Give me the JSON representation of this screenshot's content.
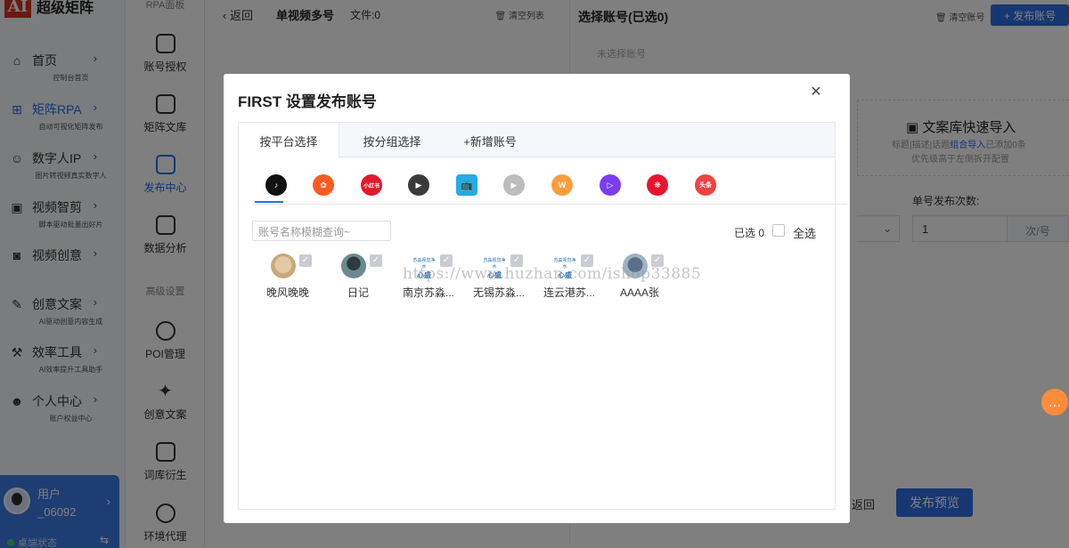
{
  "app": {
    "logo_mark": "AI",
    "logo_text": "超级矩阵"
  },
  "sidebar": {
    "items": [
      {
        "label": "首页",
        "sub": "控制台首页",
        "icon": "home-icon"
      },
      {
        "label": "矩阵RPA",
        "sub": "自动可视化矩阵发布",
        "icon": "rpa-icon"
      },
      {
        "label": "数字人IP",
        "sub": "图片转视频真实数字人",
        "icon": "robot-icon"
      },
      {
        "label": "视频智剪",
        "sub": "脚本驱动批量出好片",
        "icon": "video-edit-icon"
      },
      {
        "label": "视频创意",
        "sub": "",
        "icon": "camera-icon"
      },
      {
        "label": "创意文案",
        "sub": "AI驱动创意内容生成",
        "icon": "copywriting-icon"
      },
      {
        "label": "效率工具",
        "sub": "AI效率提升工具助手",
        "icon": "tools-icon"
      },
      {
        "label": "个人中心",
        "sub": "账户权益中心",
        "icon": "user-icon"
      }
    ],
    "arrow": "›",
    "user": {
      "name": "用户\n_06092",
      "status": "桌端状态",
      "arrow": "›",
      "toggle": "⇆"
    }
  },
  "toolbar": {
    "top_partial": "RPA面板",
    "items": [
      "账号授权",
      "矩阵文库",
      "发布中心",
      "数据分析"
    ],
    "section": "高级设置",
    "items2": [
      "POI管理",
      "创意文案",
      "词库衍生",
      "环境代理"
    ]
  },
  "mid": {
    "back": "‹  返回",
    "title": "单视频多号",
    "file_count": "文件:0",
    "clear": "清空列表"
  },
  "right": {
    "title": "选择账号(已选0)",
    "clear": "清空账号",
    "publish": "+ 发布账号",
    "unselected": "未选择账号",
    "import_title": "文案库快速导入",
    "import_line1_pre": "标题|描述|话题",
    "import_line1_link": "组合导入",
    "import_line1_post": "已添加0条",
    "import_line2": "优先级高于左侧拆开配置",
    "count_label": "单号发布次数:",
    "count_value": "1",
    "count_unit": "次/号",
    "return": "返回",
    "preview": "发布预览"
  },
  "dialog": {
    "title": "FIRST 设置发布账号",
    "close": "✕",
    "tabs": [
      "按平台选择",
      "按分组选择",
      "+新增账号"
    ],
    "platforms": [
      {
        "name": "douyin-icon",
        "glyph": "♪",
        "color": "#111111"
      },
      {
        "name": "kuaishou-icon",
        "glyph": "✿",
        "color": "#ff5a1f"
      },
      {
        "name": "xiaohongshu-icon",
        "glyph": "小红书",
        "color": "#e3182d"
      },
      {
        "name": "video-channel-icon",
        "glyph": "▶",
        "color": "#3a3a3a"
      },
      {
        "name": "bilibili-icon",
        "glyph": "📺",
        "color": "#23ade5"
      },
      {
        "name": "xigua-icon",
        "glyph": "▶",
        "color": "#bcbcbc"
      },
      {
        "name": "wechat-channels-icon",
        "glyph": "W",
        "color": "#fa9d3b"
      },
      {
        "name": "haokan-icon",
        "glyph": "▷",
        "color": "#7b3df0"
      },
      {
        "name": "weibo-icon",
        "glyph": "❋",
        "color": "#e6162d"
      },
      {
        "name": "toutiao-icon",
        "glyph": "头条",
        "color": "#f04142"
      }
    ],
    "search_placeholder": "账号名称模糊查询~",
    "selected_count": "已选 0",
    "select_all": "全选",
    "accounts": [
      {
        "name": "晚风晚晚",
        "avatar": "dog"
      },
      {
        "name": "日记",
        "avatar": "girl"
      },
      {
        "name": "南京苏淼...",
        "avatar": "logo"
      },
      {
        "name": "无锡苏淼...",
        "avatar": "logo"
      },
      {
        "name": "连云港苏...",
        "avatar": "logo"
      },
      {
        "name": "AAAA张",
        "avatar": "man"
      }
    ],
    "logo_text_small": "苏淼视觉净水",
    "logo_text_big": "心盛"
  },
  "watermark": "https://www.huzhan.com/ishop33885",
  "chat_icon": "…"
}
